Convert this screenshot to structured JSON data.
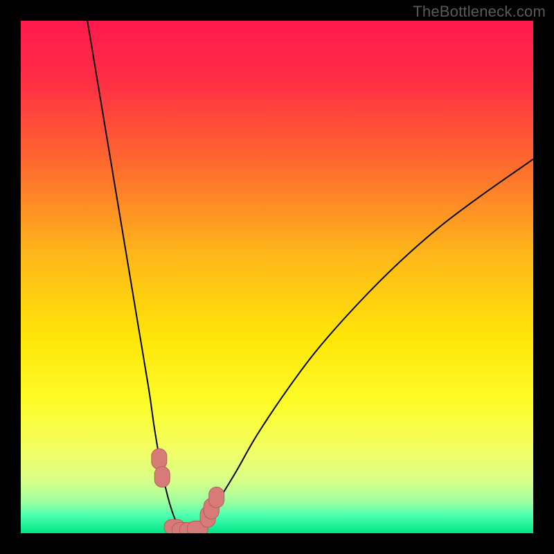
{
  "watermark": "TheBottleneck.com",
  "colors": {
    "frame": "#000000",
    "gradient_stops": [
      {
        "offset": 0.0,
        "color": "#ff1a4d"
      },
      {
        "offset": 0.12,
        "color": "#ff2f44"
      },
      {
        "offset": 0.28,
        "color": "#ff6a2e"
      },
      {
        "offset": 0.45,
        "color": "#ffb51a"
      },
      {
        "offset": 0.62,
        "color": "#ffe608"
      },
      {
        "offset": 0.75,
        "color": "#fdfd2a"
      },
      {
        "offset": 0.84,
        "color": "#f2ff66"
      },
      {
        "offset": 0.9,
        "color": "#d6ff8a"
      },
      {
        "offset": 0.94,
        "color": "#9cffa0"
      },
      {
        "offset": 0.965,
        "color": "#4dffb0"
      },
      {
        "offset": 1.0,
        "color": "#00e585"
      }
    ],
    "curve": "#000000",
    "marker_fill": "#d77b78",
    "marker_stroke": "#b65d5a"
  },
  "chart_data": {
    "type": "line",
    "title": "",
    "xlabel": "",
    "ylabel": "",
    "xlim": [
      0,
      100
    ],
    "ylim": [
      0,
      100
    ],
    "legend": false,
    "grid": false,
    "series": [
      {
        "name": "bottleneck-curve",
        "x": [
          13,
          15,
          17,
          19,
          21,
          23,
          25,
          26,
          27,
          28,
          29,
          30,
          31,
          32,
          33,
          34,
          36,
          38,
          42,
          46,
          52,
          58,
          66,
          74,
          82,
          90,
          100
        ],
        "y": [
          100,
          88,
          76,
          64,
          52,
          40,
          28,
          21,
          15,
          10,
          6,
          3,
          1.2,
          0.5,
          0.5,
          1.0,
          2.5,
          5.5,
          12,
          19,
          28,
          36,
          45,
          53,
          60,
          66,
          73
        ]
      }
    ],
    "markers": {
      "name": "highlighted-points",
      "x": [
        27.0,
        27.6,
        30.0,
        31.5,
        33.0,
        34.5,
        36.5,
        37.2,
        38.2
      ],
      "y": [
        14.5,
        11.0,
        1.2,
        0.6,
        0.6,
        0.9,
        3.2,
        4.8,
        7.0
      ]
    }
  }
}
